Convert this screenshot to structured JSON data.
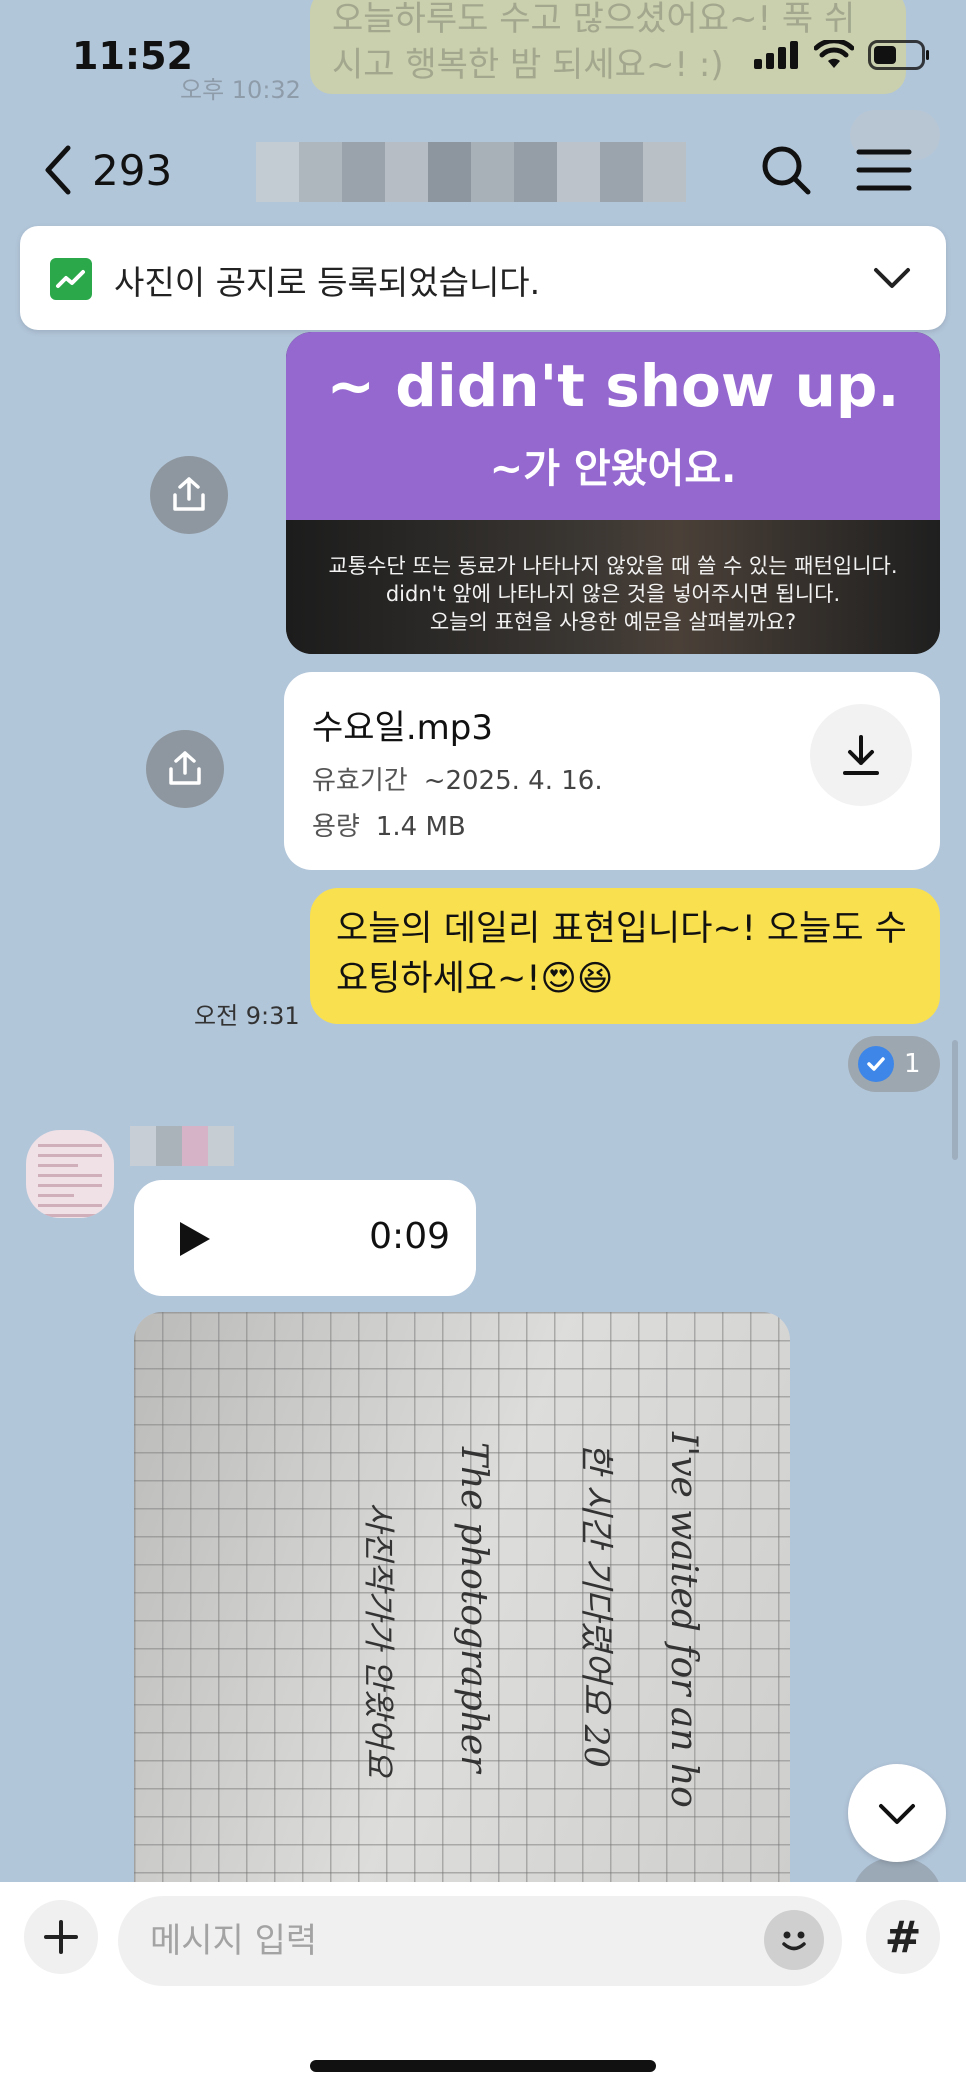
{
  "status_bar": {
    "time": "11:52"
  },
  "background_message": {
    "text": "오늘하루도 수고 많으셨어요~! 푹 쉬시고 행복한 밤 되세요~! :)",
    "time": "오후 10:32"
  },
  "header": {
    "member_count": "293"
  },
  "notice": {
    "text": "사진이 공지로 등록되었습니다."
  },
  "lesson_image": {
    "title": "~ didn't show up.",
    "subtitle": "~가 안왔어요.",
    "description_lines": [
      "교통수단 또는 동료가 나타나지 않았을 때 쓸 수 있는 패턴입니다.",
      "didn't 앞에 나타나지 않은 것을 넣어주시면 됩니다.",
      "오늘의 표현을 사용한 예문을 살펴볼까요?"
    ]
  },
  "file": {
    "name": "수요일.mp3",
    "expiry_label": "유효기간",
    "expiry_value": "~2025. 4. 16.",
    "size_label": "용량",
    "size_value": "1.4 MB"
  },
  "sent_message": {
    "text": "오늘의 데일리 표현입니다~! 오늘도 수요팅하세요~!😍😆",
    "time": "오전 9:31",
    "unread_count": "1"
  },
  "voice_message": {
    "duration": "0:09"
  },
  "handwriting": {
    "line1": "I've waited for an ho",
    "line2": "한 시간 기다렸어요 20",
    "line3": "The photographer",
    "line4": "사진작가가 안왔어요"
  },
  "composer": {
    "placeholder": "메시지 입력",
    "hash": "#"
  },
  "colors": {
    "chat_bg": "#b2c6da",
    "sent_bubble": "#f9e04e",
    "accent_purple": "#9468cf",
    "read_blue": "#3e86e8"
  }
}
